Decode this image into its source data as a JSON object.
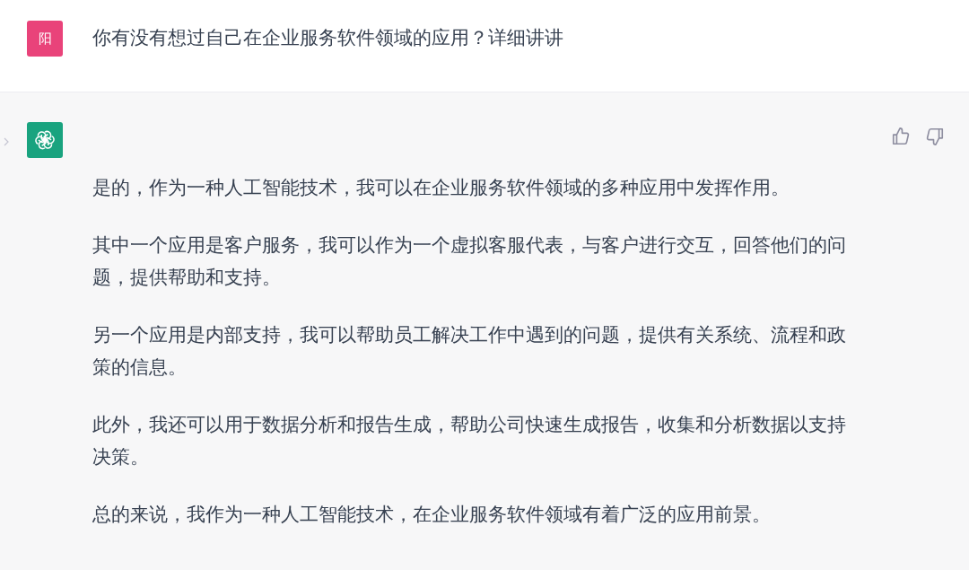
{
  "user_message": {
    "avatar": "阳",
    "text": "你有没有想过自己在企业服务软件领域的应用？详细讲讲"
  },
  "assistant_message": {
    "paragraphs": [
      "是的，作为一种人工智能技术，我可以在企业服务软件领域的多种应用中发挥作用。",
      "其中一个应用是客户服务，我可以作为一个虚拟客服代表，与客户进行交互，回答他们的问题，提供帮助和支持。",
      "另一个应用是内部支持，我可以帮助员工解决工作中遇到的问题，提供有关系统、流程和政策的信息。",
      "此外，我还可以用于数据分析和报告生成，帮助公司快速生成报告，收集和分析数据以支持决策。",
      "总的来说，我作为一种人工智能技术，在企业服务软件领域有着广泛的应用前景。"
    ]
  }
}
